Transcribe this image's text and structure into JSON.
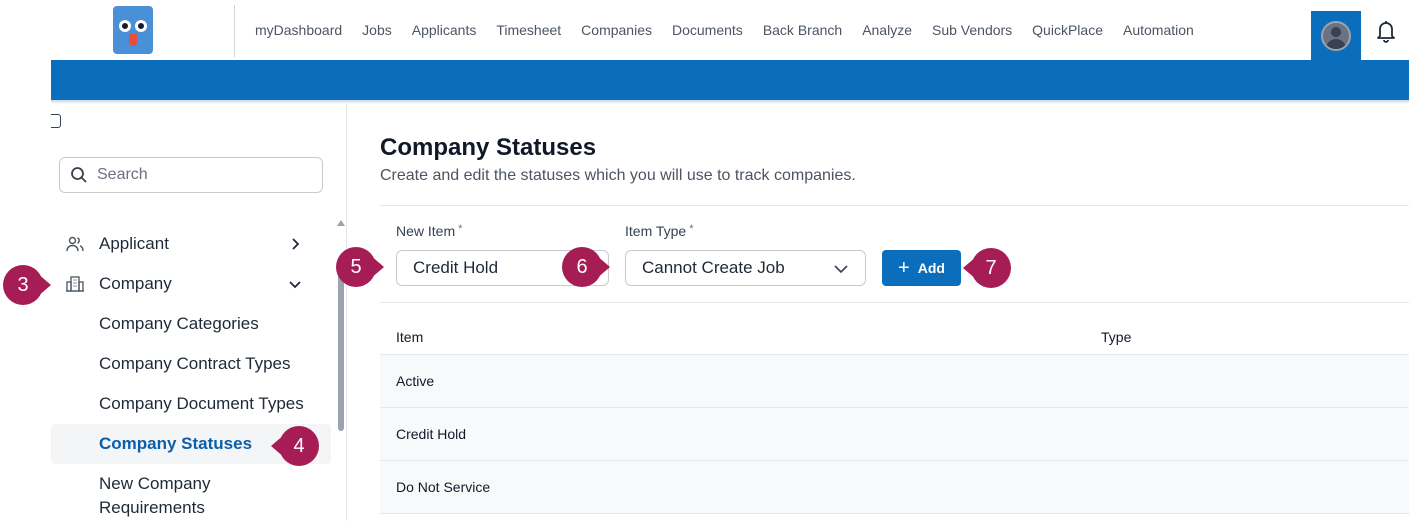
{
  "nav": {
    "items": [
      "myDashboard",
      "Jobs",
      "Applicants",
      "Timesheet",
      "Companies",
      "Documents",
      "Back Branch",
      "Analyze",
      "Sub Vendors",
      "QuickPlace",
      "Automation"
    ]
  },
  "sidebar": {
    "search_placeholder": "Search",
    "menu": [
      {
        "label": "Applicant",
        "icon": "users-icon",
        "expanded": false
      },
      {
        "label": "Company",
        "icon": "building-icon",
        "expanded": true
      }
    ],
    "company_sub": [
      {
        "label": "Company Categories",
        "active": false
      },
      {
        "label": "Company Contract Types",
        "active": false
      },
      {
        "label": "Company Document Types",
        "active": false
      },
      {
        "label": "Company Statuses",
        "active": true
      },
      {
        "label": "New Company Requirements",
        "active": false
      }
    ]
  },
  "main": {
    "title": "Company Statuses",
    "subtitle": "Create and edit the statuses which you will use to track companies.",
    "form": {
      "new_item_label": "New Item",
      "new_item_value": "Credit Hold",
      "item_type_label": "Item Type",
      "item_type_value": "Cannot Create Job",
      "required_mark": "*",
      "add_label": "Add"
    },
    "table": {
      "headers": [
        "Item",
        "Type"
      ],
      "rows": [
        "Active",
        "Credit Hold",
        "Do Not Service"
      ]
    }
  },
  "callouts": [
    "3",
    "4",
    "5",
    "6",
    "7"
  ],
  "colors": {
    "brand_blue": "#0b6ebd",
    "callout": "#a61c55",
    "active_link": "#0b5ea8"
  }
}
